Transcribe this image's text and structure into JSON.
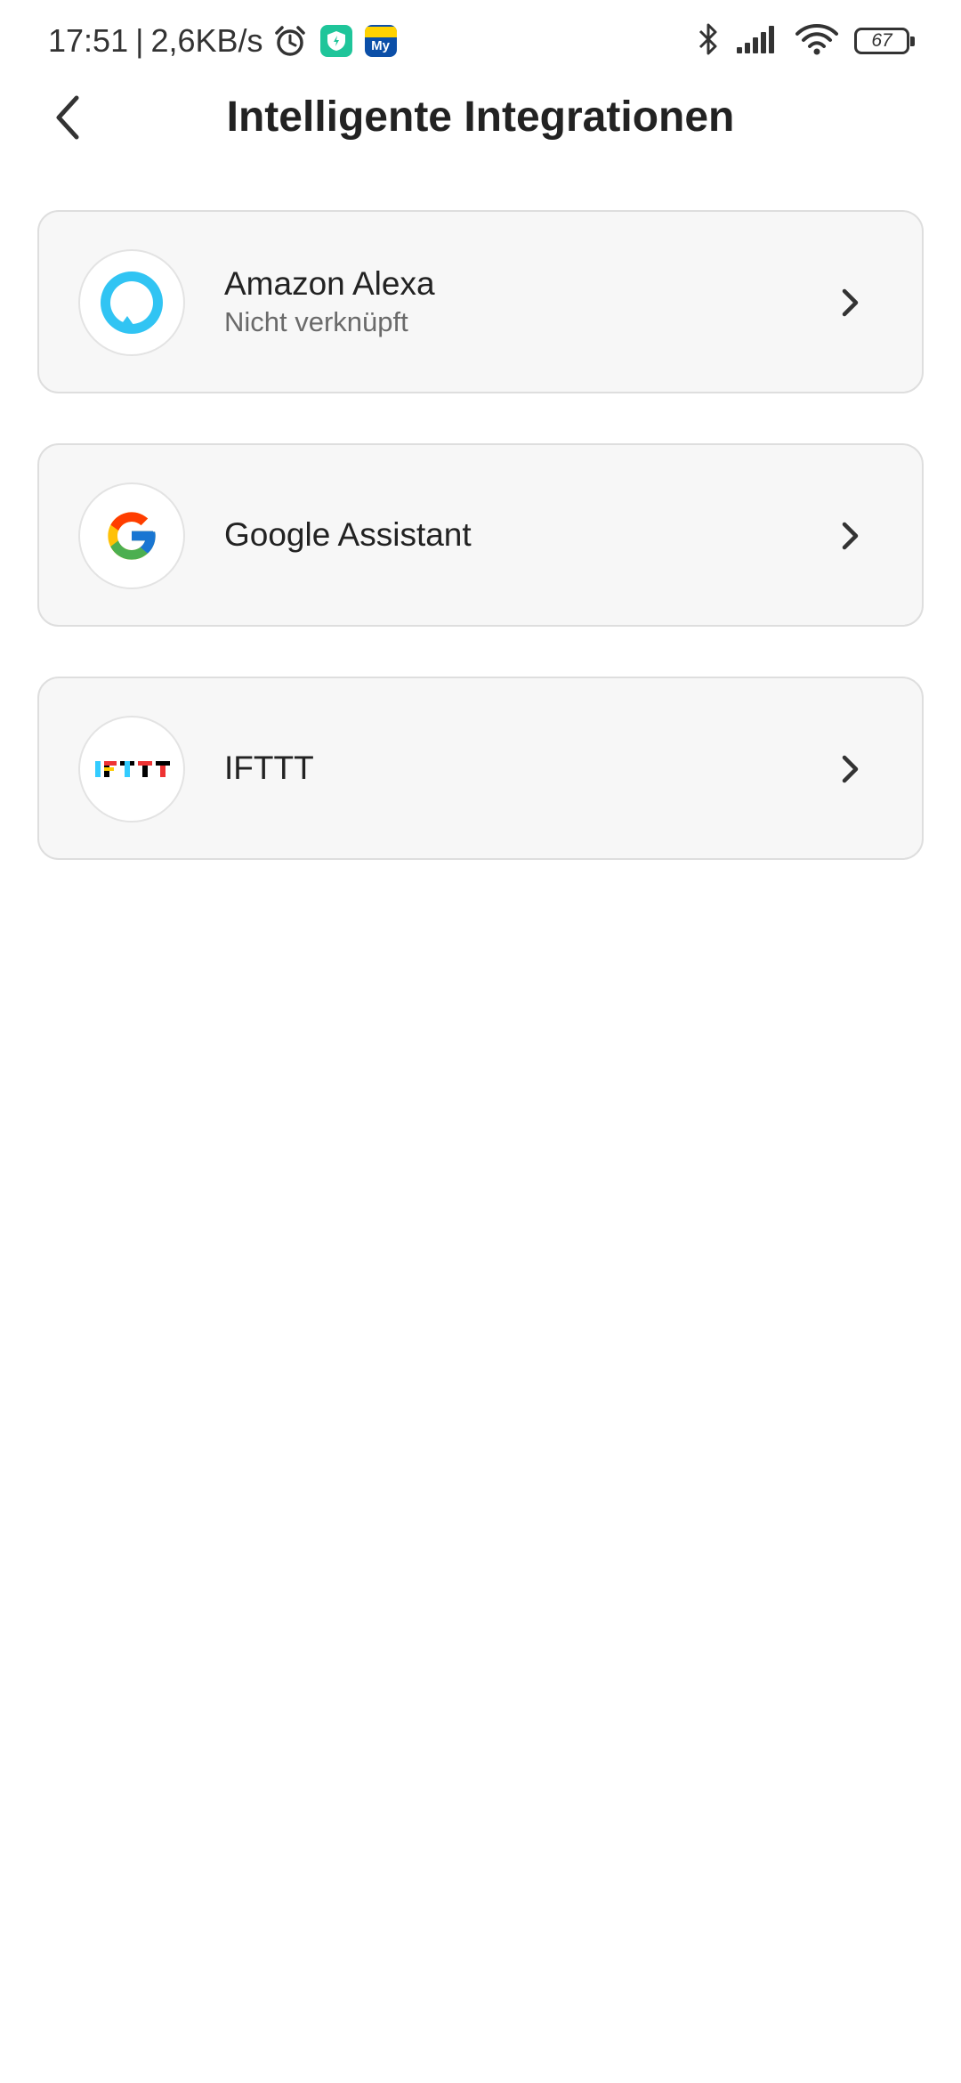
{
  "status_bar": {
    "time": "17:51",
    "separator": "|",
    "speed": "2,6KB/s",
    "battery": "67",
    "app_icon_my": "My",
    "icons": [
      "alarm-icon",
      "shield-app-icon",
      "my-app-icon",
      "bluetooth-icon",
      "signal-icon",
      "wifi-icon",
      "battery-icon"
    ]
  },
  "header": {
    "title": "Intelligente Integrationen",
    "back_icon": "chevron-left-icon"
  },
  "integrations": [
    {
      "name": "Amazon Alexa",
      "status": "Nicht verknüpft",
      "icon": "alexa-icon"
    },
    {
      "name": "Google Assistant",
      "status": "",
      "icon": "google-icon"
    },
    {
      "name": "IFTTT",
      "status": "",
      "icon": "ifttt-icon"
    }
  ],
  "colors": {
    "alexa": "#31c4f3",
    "google_red": "#ea4335",
    "google_yellow": "#fbbc05",
    "google_green": "#34a853",
    "google_blue": "#4285f4",
    "card_bg": "#f7f7f7"
  }
}
